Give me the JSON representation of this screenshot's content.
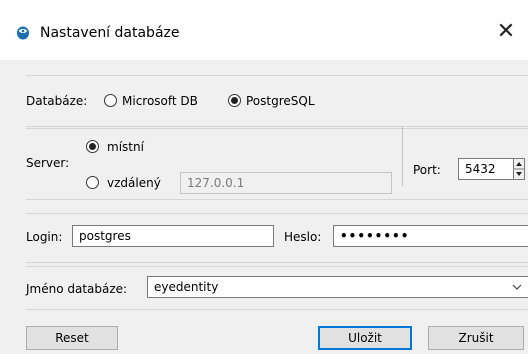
{
  "window": {
    "title": "Nastavení databáze",
    "close_glyph": "✕"
  },
  "database": {
    "label": "Databáze:",
    "options": [
      {
        "label": "Microsoft DB",
        "selected": false
      },
      {
        "label": "PostgreSQL",
        "selected": true
      }
    ]
  },
  "server": {
    "label": "Server:",
    "local_label": "místní",
    "remote_label": "vzdálený",
    "local_selected": true,
    "remote_address": "127.0.0.1",
    "port_label": "Port:",
    "port_value": "5432"
  },
  "credentials": {
    "login_label": "Login:",
    "login_value": "postgres",
    "password_label": "Heslo:",
    "password_value": "••••••••"
  },
  "dbname": {
    "label": "Jméno databáze:",
    "value": "eyedentity"
  },
  "buttons": {
    "reset": "Reset",
    "save": "Uložit",
    "cancel": "Zrušit"
  },
  "colors": {
    "accent": "#0078d7",
    "app_icon": "#1a6fb0"
  }
}
